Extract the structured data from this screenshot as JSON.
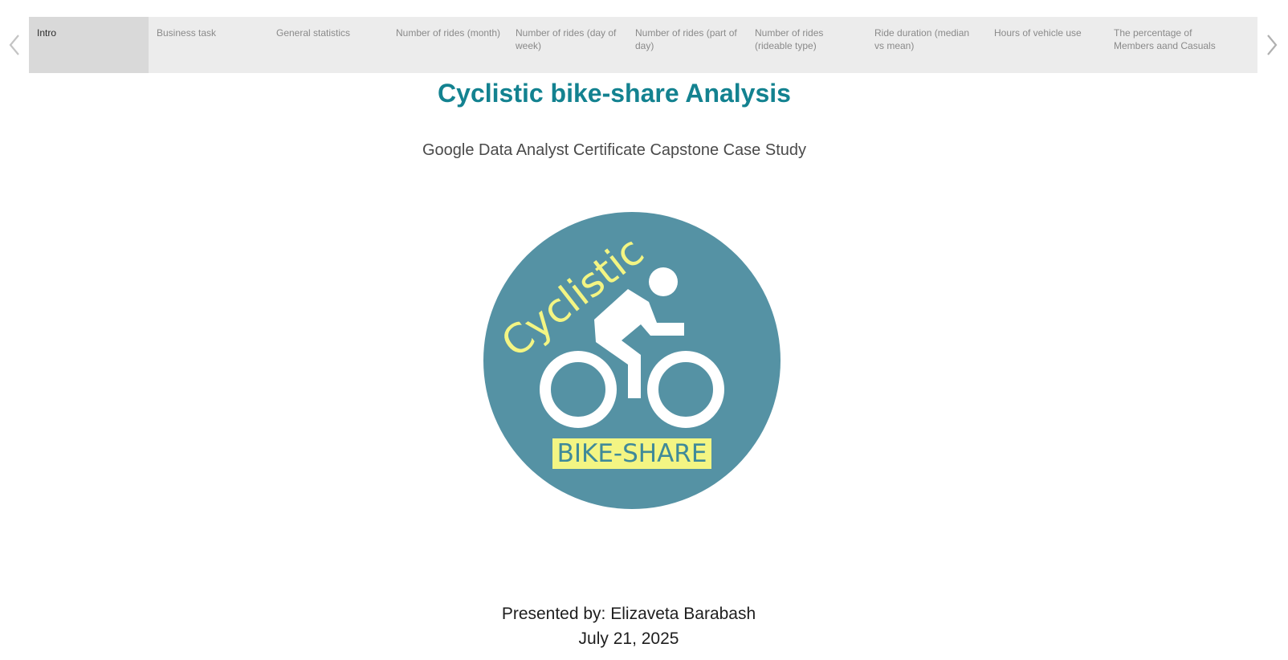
{
  "story": {
    "tabs": [
      {
        "label": "Intro",
        "active": true
      },
      {
        "label": "Business task",
        "active": false
      },
      {
        "label": "General statistics",
        "active": false
      },
      {
        "label": "Number of rides (month)",
        "active": false
      },
      {
        "label": "Number of rides (day of week)",
        "active": false
      },
      {
        "label": "Number of rides  (part of day)",
        "active": false
      },
      {
        "label": "Number of rides (rideable type)",
        "active": false
      },
      {
        "label": "Ride duration (median vs mean)",
        "active": false
      },
      {
        "label": "Hours of vehicle use",
        "active": false
      },
      {
        "label": "The percentage of Members aand Casuals",
        "active": false
      }
    ],
    "prev_icon": "chevron-left-icon",
    "next_icon": "chevron-right-icon"
  },
  "content": {
    "title": "Cyclistic bike-share Analysis",
    "subtitle": "Google Data Analyst Certificate Capstone Case Study",
    "presenter": "Presented by: Elizaveta Barabash",
    "date": "July 21, 2025"
  },
  "logo": {
    "wordmark": "Cyclistic",
    "caption": "BIKE-SHARE",
    "icon": "cyclist-icon"
  },
  "colors": {
    "accent": "#138290",
    "logo_circle": "#5592a4",
    "logo_yellow": "#f3f583",
    "tab_bg": "#ececec",
    "tab_active_bg": "#d9d9d9"
  }
}
